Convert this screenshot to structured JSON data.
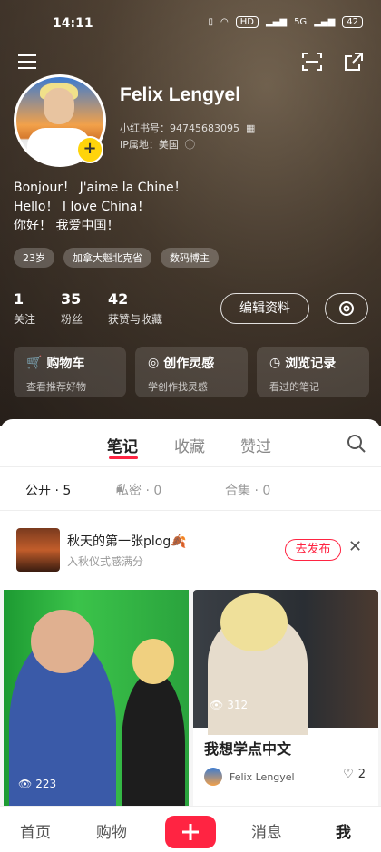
{
  "status_bar": {
    "time": "14:11",
    "network_badge": "HD",
    "signal_label": "5G",
    "battery": "42"
  },
  "profile": {
    "name": "Felix Lengyel",
    "redbook_id": "小红书号：94745683095",
    "ip_location": "IP属地：美国",
    "bio": [
      "Bonjour！ J'aime la Chine！",
      "Hello！ I love China！",
      "你好！ 我爱中国！"
    ],
    "tags": [
      "23岁",
      "加拿大魁北克省",
      "数码博主"
    ],
    "stats": [
      {
        "num": "1",
        "label": "关注"
      },
      {
        "num": "35",
        "label": "粉丝"
      },
      {
        "num": "42",
        "label": "获赞与收藏"
      }
    ],
    "edit_label": "编辑资料"
  },
  "shortcuts": [
    {
      "title": "购物车",
      "subtitle": "查看推荐好物",
      "icon": "cart-icon"
    },
    {
      "title": "创作灵感",
      "subtitle": "学创作找灵感",
      "icon": "lightbulb-icon"
    },
    {
      "title": "浏览记录",
      "subtitle": "看过的笔记",
      "icon": "clock-icon"
    }
  ],
  "content_tabs": [
    "笔记",
    "收藏",
    "赞过"
  ],
  "sub_tabs": {
    "public": "公开 · 5",
    "private": "私密 · 0",
    "collection": "合集 · 0"
  },
  "draft": {
    "title": "秋天的第一张plog🍂",
    "subtitle": "入秋仪式感满分",
    "publish_label": "去发布"
  },
  "notes": [
    {
      "views": "223"
    },
    {
      "views": "312",
      "title": "我想学点中文",
      "author": "Felix Lengyel",
      "likes": "2"
    }
  ],
  "bottom_nav": {
    "home": "首页",
    "shop": "购物",
    "messages": "消息",
    "me": "我"
  },
  "colors": {
    "accent": "#ff2442",
    "badge_yellow": "#ffd40b"
  }
}
